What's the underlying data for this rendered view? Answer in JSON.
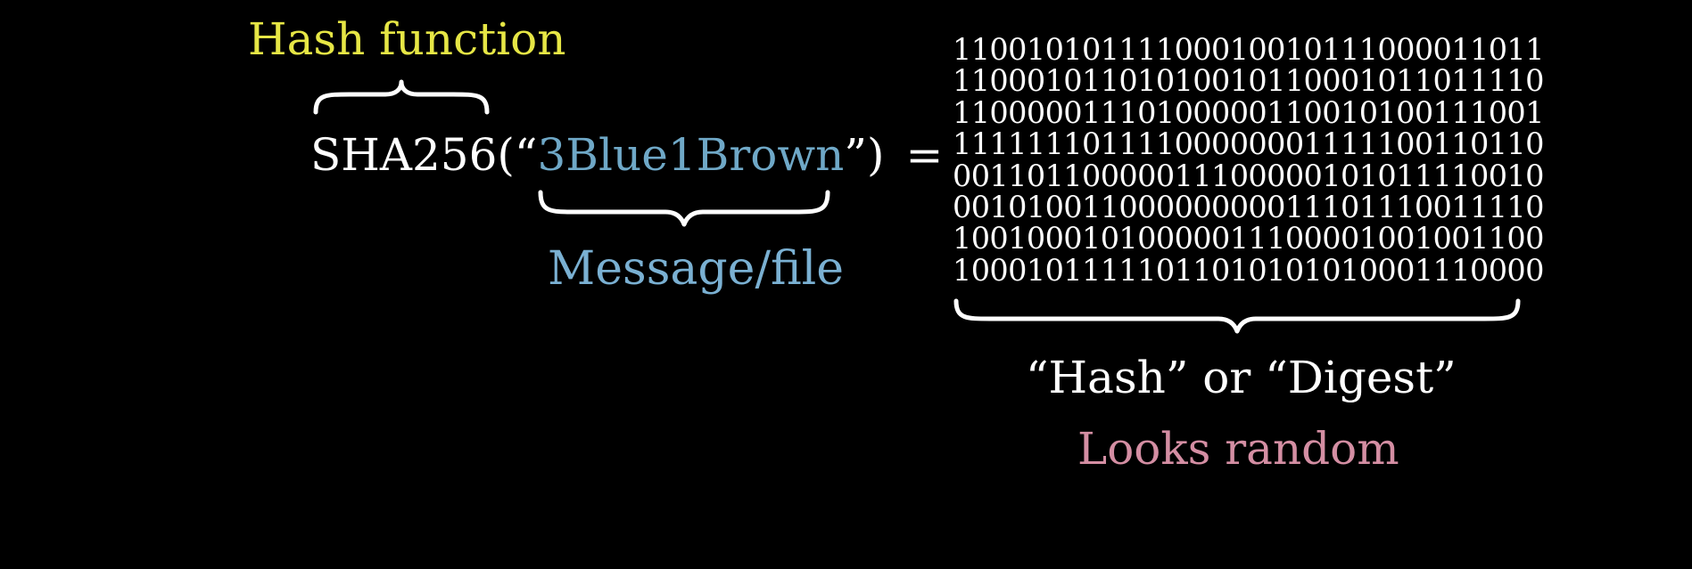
{
  "hash_function_label": "Hash function",
  "expression": {
    "function_name": "SHA256(",
    "open_quote": "“",
    "message": "3Blue1Brown",
    "close_quote": "”",
    "close_paren": ")",
    "equals": "="
  },
  "message_label": "Message/file",
  "digest_bits": [
    "11001010111100010010111000011011",
    "11000101101010010110001011011110",
    "11000001110100000110010100111001",
    "11111110111100000001111100110110",
    "00110110000011100000101011110010",
    "00101001100000000011101110011110",
    "10010001010000011100001001001100",
    "10001011111011010101010001110000"
  ],
  "hash_or_digest_label": "“Hash” or “Digest”",
  "looks_random_label": "Looks random",
  "colors": {
    "background": "#000000",
    "hash_function": "#e6e645",
    "message": "#7ab0d2",
    "looks_random": "#d48ea3",
    "foreground": "#ffffff"
  }
}
